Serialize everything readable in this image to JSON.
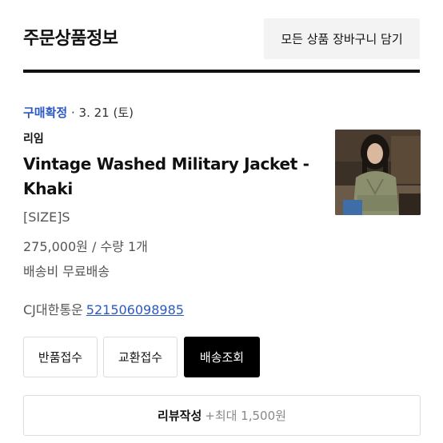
{
  "header": {
    "title": "주문상품정보",
    "cart_all_label": "모든 상품 장바구니 담기"
  },
  "order": {
    "status": "구매확정",
    "separator": "·",
    "date": "3. 21 (토)",
    "brand": "리임",
    "product_name": "Vintage Washed Military Jacket - Khaki",
    "size": "[SIZE]S",
    "price_qty": "275,000원 / 수량 1개",
    "shipping_fee": "배송비 무료배송",
    "carrier": "CJ대한통운",
    "tracking_number": "521506098985"
  },
  "actions": {
    "return_label": "반품접수",
    "exchange_label": "교환접수",
    "track_label": "배송조회",
    "review_label": "리뷰작성",
    "review_points": "+최대 1,500원"
  },
  "colors": {
    "accent_blue": "#2b59c3",
    "primary_dark": "#000000",
    "button_gray": "#f3f3f3"
  }
}
